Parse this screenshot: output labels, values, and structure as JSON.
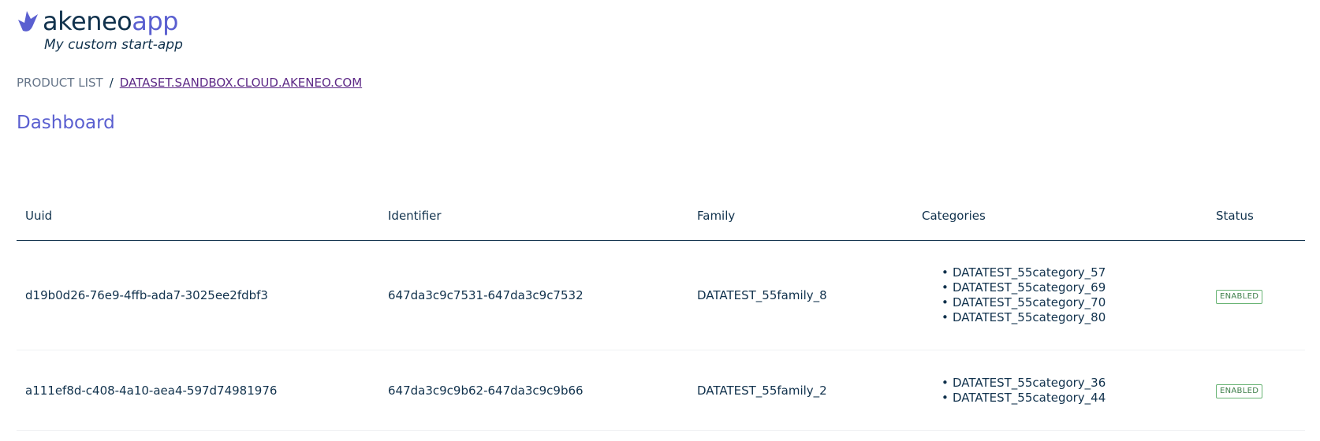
{
  "brand": {
    "name_part1": "akeneo",
    "name_part2": "app",
    "tagline": "My custom start-app",
    "logo_icon": "akeneo-logo-icon",
    "colors": {
      "primary": "#5a5fd0",
      "text": "#11324d",
      "link": "#5e2a87",
      "status_green": "#67b373"
    }
  },
  "breadcrumb": {
    "root": "PRODUCT LIST",
    "separator": "/",
    "link": "DATASET.SANDBOX.CLOUD.AKENEO.COM"
  },
  "page": {
    "title": "Dashboard"
  },
  "table": {
    "columns": [
      "Uuid",
      "Identifier",
      "Family",
      "Categories",
      "Status"
    ],
    "rows": [
      {
        "uuid": "d19b0d26-76e9-4ffb-ada7-3025ee2fdbf3",
        "identifier": "647da3c9c7531-647da3c9c7532",
        "family": "DATATEST_55family_8",
        "categories": [
          "DATATEST_55category_57",
          "DATATEST_55category_69",
          "DATATEST_55category_70",
          "DATATEST_55category_80"
        ],
        "status": "ENABLED"
      },
      {
        "uuid": "a111ef8d-c408-4a10-aea4-597d74981976",
        "identifier": "647da3c9c9b62-647da3c9c9b66",
        "family": "DATATEST_55family_2",
        "categories": [
          "DATATEST_55category_36",
          "DATATEST_55category_44"
        ],
        "status": "ENABLED"
      }
    ]
  }
}
